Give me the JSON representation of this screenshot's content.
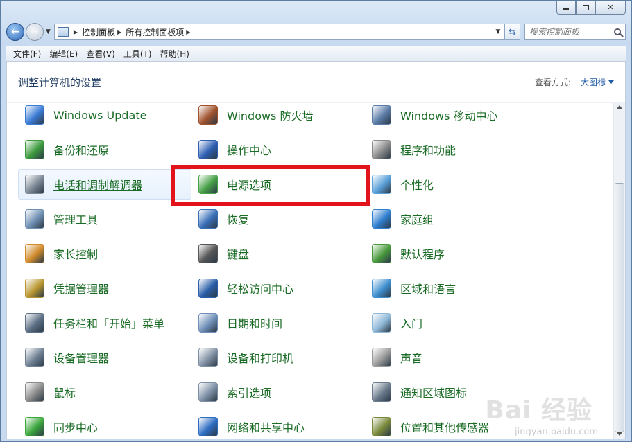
{
  "window": {
    "caption_buttons": {
      "minimize": "minimize",
      "maximize": "maximize",
      "close": "✕"
    }
  },
  "address_bar": {
    "crumbs": [
      "控制面板",
      "所有控制面板项"
    ]
  },
  "search": {
    "placeholder": "搜索控制面板"
  },
  "menu": [
    "文件(F)",
    "编辑(E)",
    "查看(V)",
    "工具(T)",
    "帮助(H)"
  ],
  "header": {
    "title": "调整计算机的设置",
    "view_by_label": "查看方式:",
    "view_by_value": "大图标"
  },
  "items": [
    {
      "label": "Windows Update",
      "icon": "windows-update-icon",
      "color": "#3a7bd5"
    },
    {
      "label": "Windows 防火墙",
      "icon": "firewall-icon",
      "color": "#a0522d"
    },
    {
      "label": "Windows 移动中心",
      "icon": "mobility-center-icon",
      "color": "#5b7ca8"
    },
    {
      "label": "备份和还原",
      "icon": "backup-restore-icon",
      "color": "#3c9a3c"
    },
    {
      "label": "操作中心",
      "icon": "action-center-flag-icon",
      "color": "#2f5fb3"
    },
    {
      "label": "程序和功能",
      "icon": "programs-features-icon",
      "color": "#8b8b8b"
    },
    {
      "label": "电话和调制解调器",
      "icon": "phone-modem-icon",
      "color": "#7b8794"
    },
    {
      "label": "电源选项",
      "icon": "power-options-icon",
      "color": "#46a046"
    },
    {
      "label": "个性化",
      "icon": "personalization-icon",
      "color": "#5aa0d8"
    },
    {
      "label": "管理工具",
      "icon": "admin-tools-icon",
      "color": "#6f8fb3"
    },
    {
      "label": "恢复",
      "icon": "recovery-icon",
      "color": "#3a6fb8"
    },
    {
      "label": "家庭组",
      "icon": "homegroup-icon",
      "color": "#2f7fd0"
    },
    {
      "label": "家长控制",
      "icon": "parental-controls-icon",
      "color": "#d08a2a"
    },
    {
      "label": "键盘",
      "icon": "keyboard-icon",
      "color": "#555555"
    },
    {
      "label": "默认程序",
      "icon": "default-programs-icon",
      "color": "#4a9a3c"
    },
    {
      "label": "凭据管理器",
      "icon": "credential-manager-icon",
      "color": "#b8962f"
    },
    {
      "label": "轻松访问中心",
      "icon": "ease-of-access-icon",
      "color": "#2a5ea8"
    },
    {
      "label": "区域和语言",
      "icon": "region-language-icon",
      "color": "#3f8fd0"
    },
    {
      "label": "任务栏和「开始」菜单",
      "icon": "taskbar-start-menu-icon",
      "color": "#5c6f85"
    },
    {
      "label": "日期和时间",
      "icon": "date-time-icon",
      "color": "#6f8fb8"
    },
    {
      "label": "入门",
      "icon": "getting-started-icon",
      "color": "#8fb8d8"
    },
    {
      "label": "设备管理器",
      "icon": "device-manager-icon",
      "color": "#6d7f92"
    },
    {
      "label": "设备和打印机",
      "icon": "devices-printers-icon",
      "color": "#7f8fa3"
    },
    {
      "label": "声音",
      "icon": "sound-icon",
      "color": "#9a9a9a"
    },
    {
      "label": "鼠标",
      "icon": "mouse-icon",
      "color": "#8a8a8a"
    },
    {
      "label": "索引选项",
      "icon": "indexing-options-icon",
      "color": "#7c8fa5"
    },
    {
      "label": "通知区域图标",
      "icon": "notification-area-icon",
      "color": "#6a7a8c"
    },
    {
      "label": "同步中心",
      "icon": "sync-center-icon",
      "color": "#3aa63a"
    },
    {
      "label": "网络和共享中心",
      "icon": "network-sharing-icon",
      "color": "#2e6dc2"
    },
    {
      "label": "位置和其他传感器",
      "icon": "location-sensors-icon",
      "color": "#7a8a3a"
    }
  ],
  "hover_item_index": 6,
  "highlighted_item_index": 7,
  "highlight_color": "#e3131b",
  "link_color": "#1a6b25",
  "watermark": {
    "brand": "Bai  经验",
    "url": "jingyan.baidu.com"
  }
}
